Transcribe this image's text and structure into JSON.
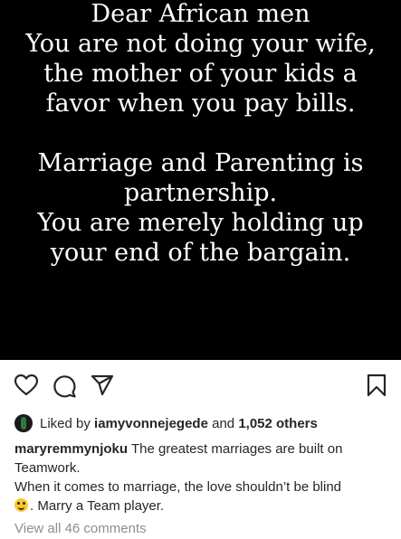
{
  "post": {
    "image_text": {
      "paragraph1": [
        "Dear African men",
        "You are not doing your wife,",
        "the mother of your kids a",
        "favor when you pay bills."
      ],
      "paragraph2": [
        "Marriage and Parenting is",
        "partnership.",
        "You are merely holding up",
        "your end of the bargain."
      ]
    }
  },
  "actions": {
    "icons": [
      "heart-icon",
      "comment-icon",
      "share-icon",
      "save-icon"
    ]
  },
  "likes": {
    "prefix": "Liked by",
    "username": "iamyvonnejegede",
    "connector": "and",
    "count": "1,052 others"
  },
  "caption": {
    "username": "maryremmynjoku",
    "line1": "The greatest marriages are built on Teamwork.",
    "line2": "When it comes to marriage, the love shouldn’t be blind",
    "line3": ". Marry a Team player."
  },
  "comments": {
    "view_all": "View all 46 comments"
  },
  "colors": {
    "image_background": "#000000",
    "text_primary": "#262626",
    "text_secondary": "#8e8e8e"
  }
}
